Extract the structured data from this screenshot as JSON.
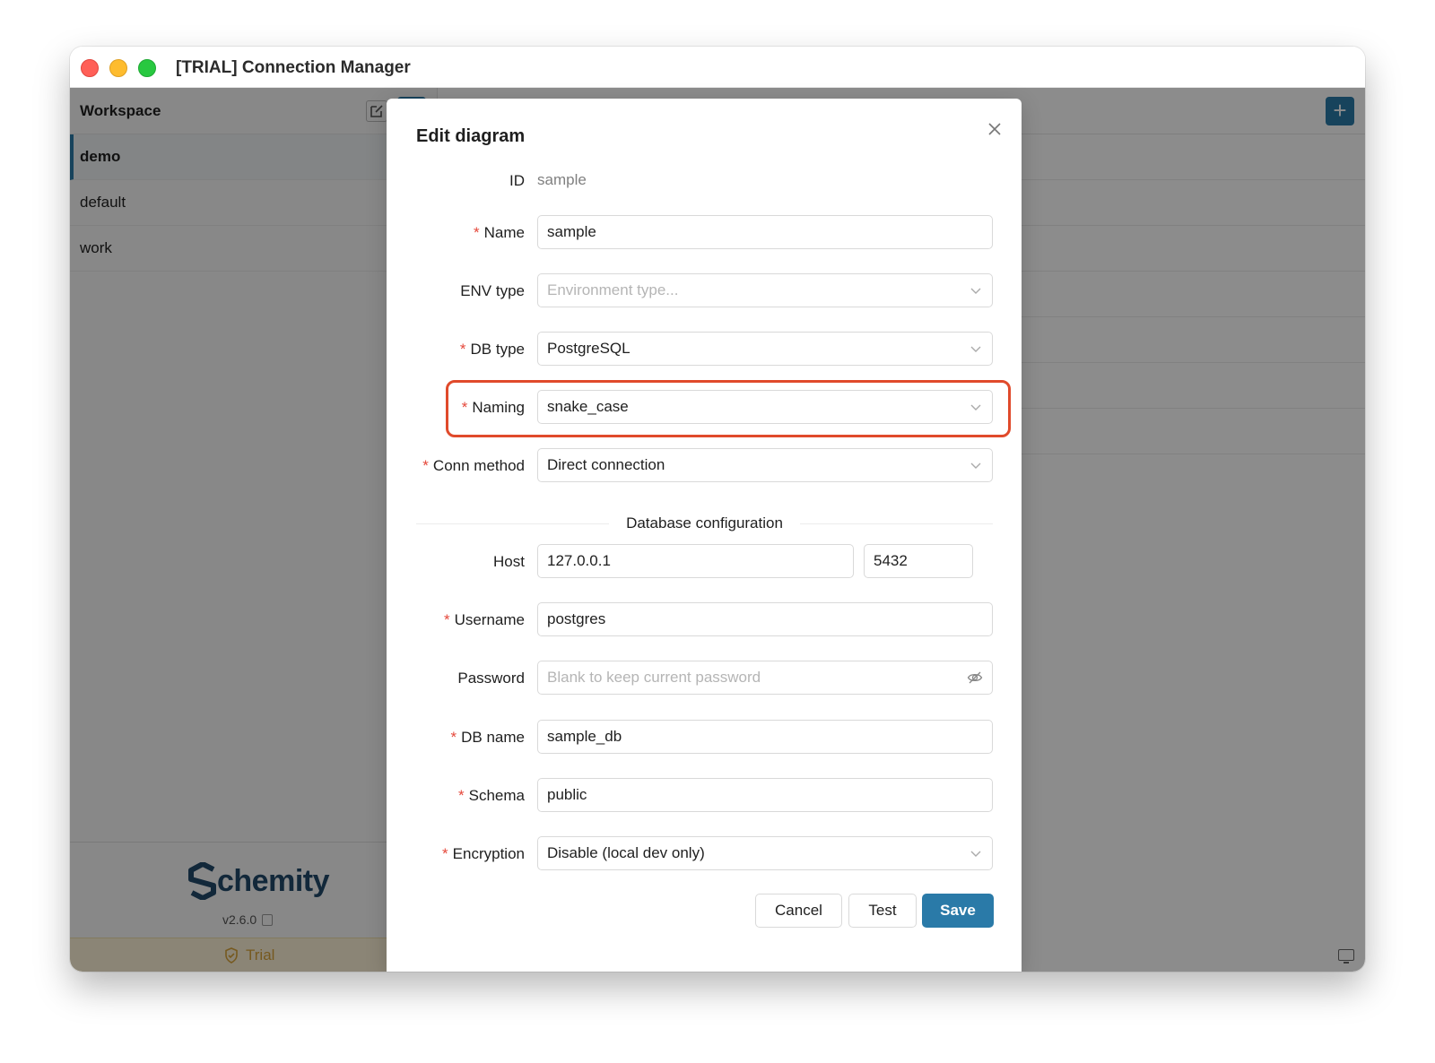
{
  "window": {
    "title": "[TRIAL] Connection Manager"
  },
  "sidebar": {
    "header_label": "Workspace",
    "items": [
      {
        "label": "demo",
        "active": true
      },
      {
        "label": "default",
        "active": false
      },
      {
        "label": "work",
        "active": false
      }
    ],
    "logo_text": "chemity",
    "version": "v2.6.0",
    "trial_label": "Trial"
  },
  "main": {
    "add_label": "+"
  },
  "modal": {
    "title": "Edit diagram",
    "id_label": "ID",
    "id_value": "sample",
    "fields": {
      "name": {
        "label": "Name",
        "value": "sample",
        "required": true
      },
      "env_type": {
        "label": "ENV type",
        "placeholder": "Environment type...",
        "required": false
      },
      "db_type": {
        "label": "DB type",
        "value": "PostgreSQL",
        "required": true
      },
      "naming": {
        "label": "Naming",
        "value": "snake_case",
        "required": true
      },
      "conn_method": {
        "label": "Conn method",
        "value": "Direct connection",
        "required": true
      },
      "host": {
        "label": "Host",
        "value": "127.0.0.1",
        "port": "5432",
        "required": false
      },
      "username": {
        "label": "Username",
        "value": "postgres",
        "required": true
      },
      "password": {
        "label": "Password",
        "placeholder": "Blank to keep current password",
        "required": false
      },
      "db_name": {
        "label": "DB name",
        "value": "sample_db",
        "required": true
      },
      "schema": {
        "label": "Schema",
        "value": "public",
        "required": true
      },
      "encryption": {
        "label": "Encryption",
        "value": "Disable (local dev only)",
        "required": true
      }
    },
    "section_title": "Database configuration",
    "required_mark": "*",
    "buttons": {
      "cancel": "Cancel",
      "test": "Test",
      "save": "Save"
    }
  },
  "colors": {
    "accent": "#2a7aa8",
    "required": "#e5483b",
    "highlight": "#e04a2b",
    "trial": "#d8a33a"
  }
}
